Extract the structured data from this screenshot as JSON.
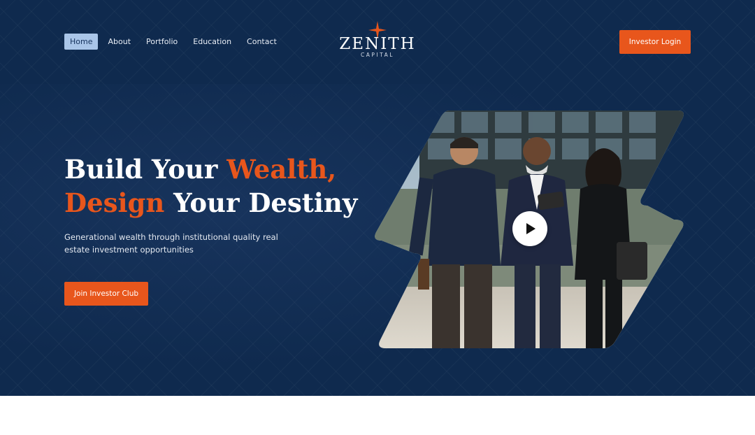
{
  "nav": {
    "items": [
      {
        "label": "Home",
        "active": true
      },
      {
        "label": "About",
        "active": false
      },
      {
        "label": "Portfolio",
        "active": false
      },
      {
        "label": "Education",
        "active": false
      },
      {
        "label": "Contact",
        "active": false
      }
    ]
  },
  "logo": {
    "name": "ZENITH",
    "sub": "CAPITAL",
    "icon": "compass-star-icon"
  },
  "header": {
    "login_label": "Investor Login"
  },
  "hero": {
    "line1_white": "Build Your ",
    "line1_accent": "Wealth,",
    "line2_accent": "Design",
    "line2_white": " Your Destiny",
    "subtext": "Generational wealth through institutional quality real estate investment opportunities",
    "cta_label": "Join Investor Club"
  },
  "media": {
    "play_icon": "play-icon"
  },
  "colors": {
    "navy": "#0f2a4e",
    "accent": "#e8561c",
    "nav_active_bg": "#a9c5e8"
  }
}
